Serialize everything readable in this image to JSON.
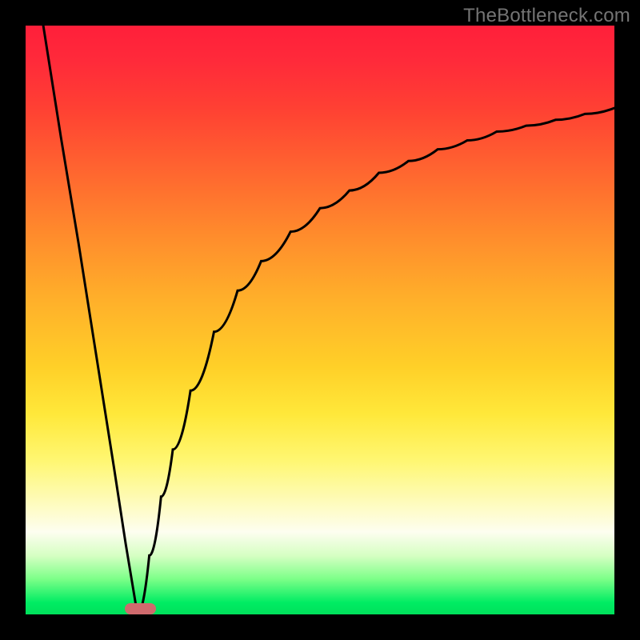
{
  "watermark": "TheBottleneck.com",
  "chart_data": {
    "type": "line",
    "title": "",
    "xlabel": "",
    "ylabel": "",
    "xlim": [
      0,
      100
    ],
    "ylim": [
      0,
      100
    ],
    "grid": false,
    "legend": false,
    "curve": {
      "description": "V-shaped curve dipping to zero near x≈19, left branch linear from top-left corner, right branch asymptotic toward ~86 at the right edge",
      "x": [
        3,
        6,
        9,
        12,
        15,
        17,
        19,
        21,
        23,
        25,
        28,
        32,
        36,
        40,
        45,
        50,
        55,
        60,
        65,
        70,
        75,
        80,
        85,
        90,
        95,
        100
      ],
      "y": [
        100,
        81,
        63,
        44,
        25,
        12,
        0,
        10,
        20,
        28,
        38,
        48,
        55,
        60,
        65,
        69,
        72,
        75,
        77,
        79,
        80.5,
        82,
        83,
        84,
        85,
        86
      ]
    },
    "marker": {
      "x_center": 19.5,
      "width_pct": 5.4,
      "height_pct": 1.9,
      "color": "#cf6a6d"
    },
    "gradient_colors": {
      "top": "#ff1f3a",
      "mid_upper": "#ff8d2c",
      "mid": "#ffe83a",
      "mid_lower": "#fdfef0",
      "bottom": "#00e05b"
    }
  }
}
